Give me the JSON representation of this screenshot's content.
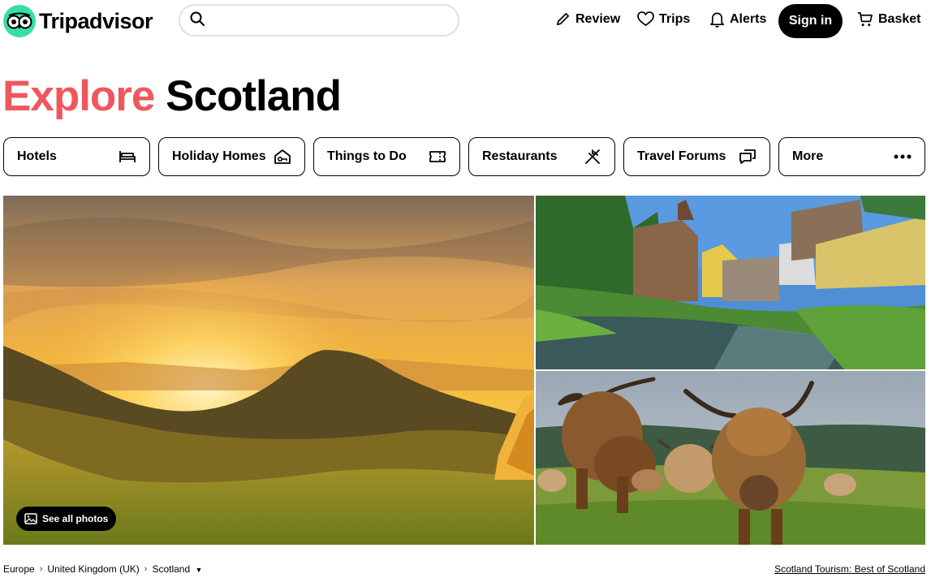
{
  "brand": {
    "name": "Tripadvisor",
    "accent": "#34E0A1"
  },
  "search": {
    "value": "",
    "placeholder": ""
  },
  "nav": {
    "review": "Review",
    "trips": "Trips",
    "alerts": "Alerts",
    "signin": "Sign in",
    "basket": "Basket"
  },
  "title": {
    "accent": "Explore",
    "rest": "Scotland",
    "accent_color": "#F0575C"
  },
  "tabs": [
    {
      "label": "Hotels",
      "icon": "bed-icon"
    },
    {
      "label": "Holiday Homes",
      "icon": "house-key-icon"
    },
    {
      "label": "Things to Do",
      "icon": "ticket-icon"
    },
    {
      "label": "Restaurants",
      "icon": "cutlery-icon"
    },
    {
      "label": "Travel Forums",
      "icon": "chat-bubble-icon"
    },
    {
      "label": "More",
      "icon": "more-dots-icon"
    }
  ],
  "photos": {
    "see_all": "See all photos"
  },
  "breadcrumb": [
    "Europe",
    "United Kingdom (UK)",
    "Scotland"
  ],
  "tourism_link": "Scotland Tourism: Best of Scotland"
}
